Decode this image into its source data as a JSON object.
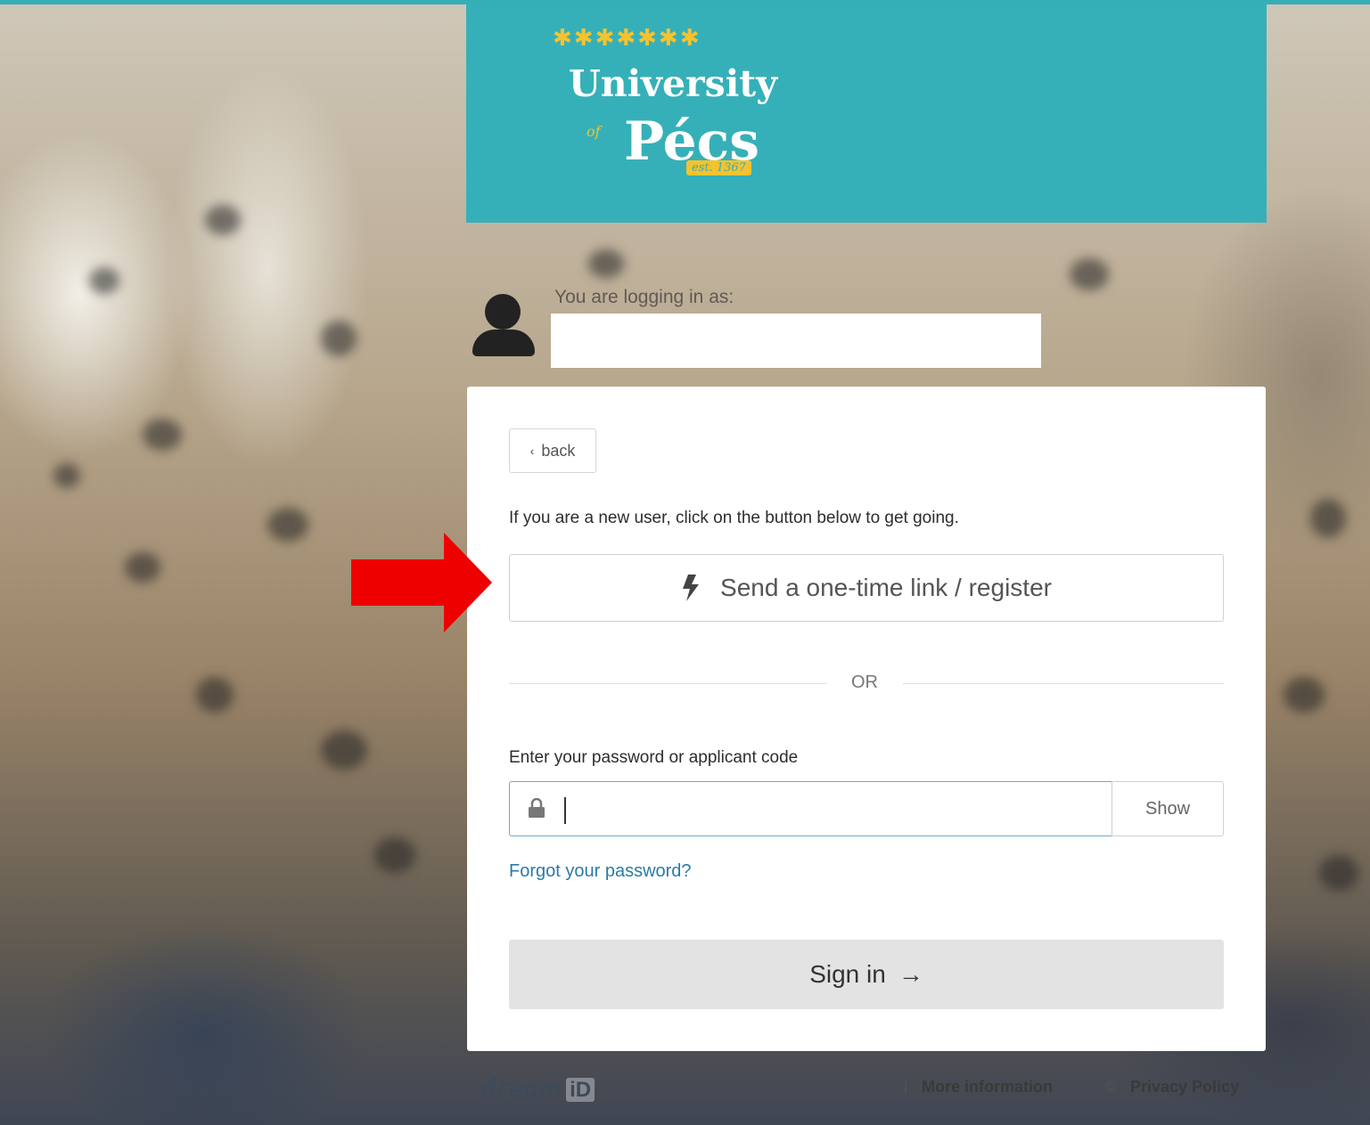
{
  "logo": {
    "stars": "✱✱✱✱✱✱✱",
    "word_university": "University",
    "word_of": "of",
    "word_pecs": "Pécs",
    "est": "est. 1367"
  },
  "login_as": {
    "label": "You are logging in as:",
    "value": ""
  },
  "card": {
    "back_label": "back",
    "new_user_text": "If you are a new user, click on the button below to get going.",
    "send_link_label": "Send a one-time link / register",
    "or_text": "OR",
    "password_label": "Enter your password or applicant code",
    "password_value": "",
    "show_label": "Show",
    "forgot_label": "Forgot your password?",
    "signin_label": "Sign in",
    "signin_arrow": "→"
  },
  "footer": {
    "brand_dream": "dream",
    "brand_id": "iD",
    "sep1": "|",
    "more_info": "More information",
    "sep2": "©",
    "privacy": "Privacy Policy"
  },
  "colors": {
    "teal": "#36b0b8",
    "logo_yellow": "#f4c32f",
    "link_blue": "#2b7aa8",
    "annotation_red": "#ee0000"
  }
}
